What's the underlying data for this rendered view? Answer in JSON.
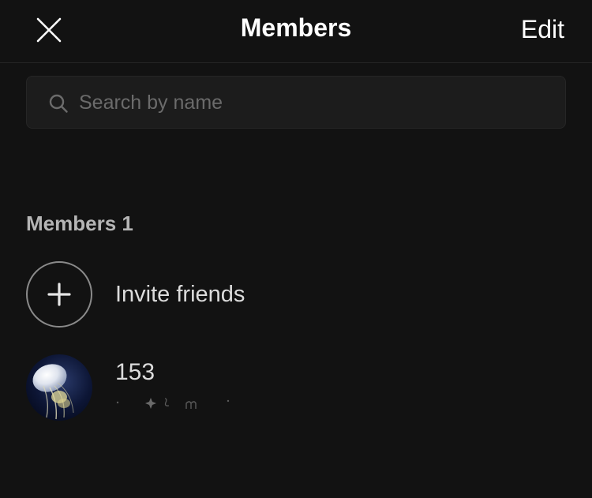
{
  "header": {
    "title": "Members",
    "edit_label": "Edit",
    "close_icon": "close-icon"
  },
  "search": {
    "placeholder": "Search by name",
    "value": "",
    "icon": "search-icon"
  },
  "section": {
    "title": "Members 1"
  },
  "invite": {
    "label": "Invite friends",
    "icon": "plus-icon"
  },
  "members": [
    {
      "name": "153",
      "avatar": "jellyfish-avatar",
      "status_icon": "sparkle-decoration"
    }
  ],
  "colors": {
    "background": "#121212",
    "search_background": "#1c1c1c",
    "text_primary": "#ffffff",
    "text_secondary": "#b5b5b5",
    "placeholder": "#6b6b6b"
  }
}
